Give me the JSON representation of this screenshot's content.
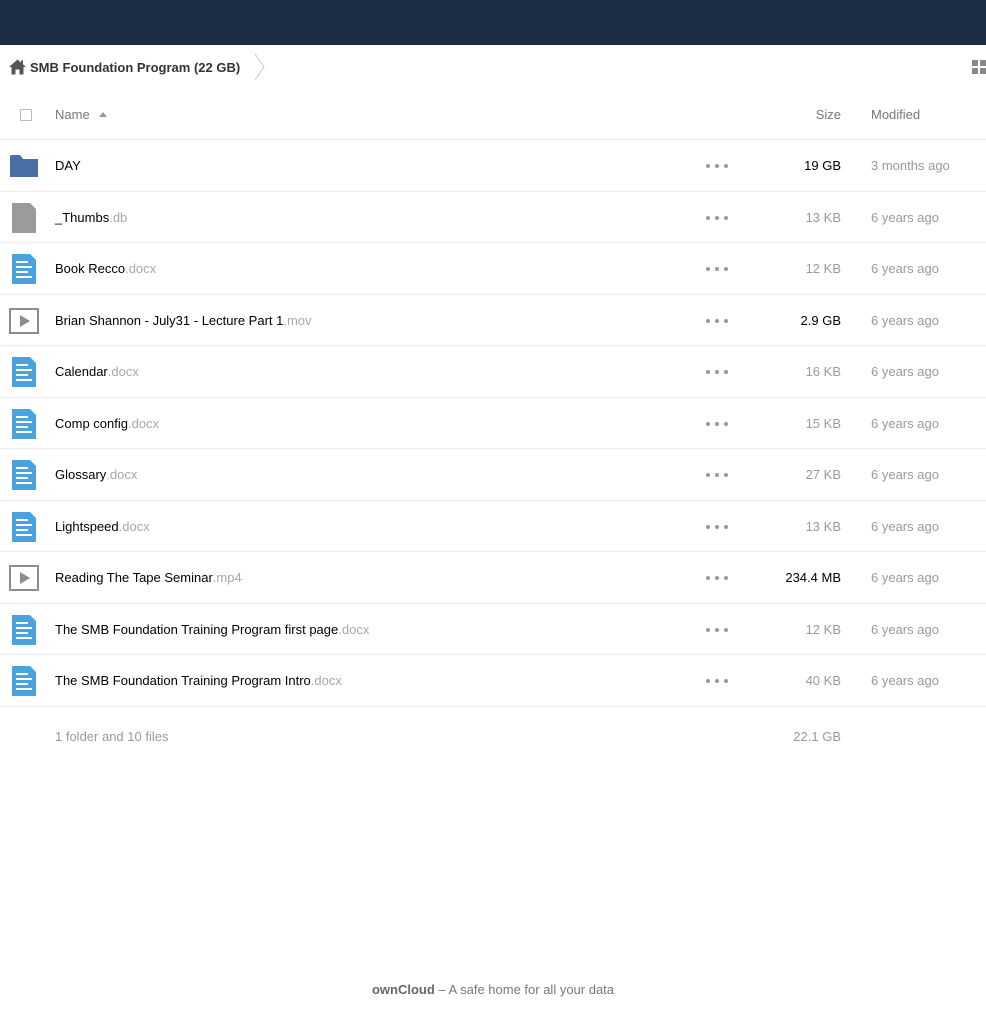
{
  "breadcrumb": {
    "label": "SMB Foundation Program (22 GB)"
  },
  "table": {
    "headers": {
      "name": "Name",
      "size": "Size",
      "modified": "Modified"
    },
    "rows": [
      {
        "type": "folder",
        "base": "DAY",
        "ext": "",
        "size": "19 GB",
        "size_color": "#000000",
        "modified": "3 months ago",
        "mod_color": "#999999"
      },
      {
        "type": "generic",
        "base": "_Thumbs",
        "ext": ".db",
        "size": "13 KB",
        "size_color": "#9a9a9a",
        "modified": "6 years ago",
        "mod_color": "#9a9a9a"
      },
      {
        "type": "document",
        "base": "Book Recco",
        "ext": ".docx",
        "size": "12 KB",
        "size_color": "#9a9a9a",
        "modified": "6 years ago",
        "mod_color": "#9a9a9a"
      },
      {
        "type": "video",
        "base": "Brian Shannon - July31 - Lecture Part 1",
        "ext": ".mov",
        "size": "2.9 GB",
        "size_color": "#000000",
        "modified": "6 years ago",
        "mod_color": "#9a9a9a"
      },
      {
        "type": "document",
        "base": "Calendar",
        "ext": ".docx",
        "size": "16 KB",
        "size_color": "#9a9a9a",
        "modified": "6 years ago",
        "mod_color": "#9a9a9a"
      },
      {
        "type": "document",
        "base": "Comp config",
        "ext": ".docx",
        "size": "15 KB",
        "size_color": "#9a9a9a",
        "modified": "6 years ago",
        "mod_color": "#9a9a9a"
      },
      {
        "type": "document",
        "base": "Glossary",
        "ext": ".docx",
        "size": "27 KB",
        "size_color": "#9a9a9a",
        "modified": "6 years ago",
        "mod_color": "#9a9a9a"
      },
      {
        "type": "document",
        "base": "Lightspeed",
        "ext": ".docx",
        "size": "13 KB",
        "size_color": "#9a9a9a",
        "modified": "6 years ago",
        "mod_color": "#9a9a9a"
      },
      {
        "type": "video",
        "base": "Reading The Tape Seminar",
        "ext": ".mp4",
        "size": "234.4 MB",
        "size_color": "#000000",
        "modified": "6 years ago",
        "mod_color": "#9a9a9a"
      },
      {
        "type": "document",
        "base": "The SMB Foundation Training Program first page",
        "ext": ".docx",
        "size": "12 KB",
        "size_color": "#9a9a9a",
        "modified": "6 years ago",
        "mod_color": "#9a9a9a"
      },
      {
        "type": "document",
        "base": "The SMB Foundation Training Program Intro",
        "ext": ".docx",
        "size": "40 KB",
        "size_color": "#9a9a9a",
        "modified": "6 years ago",
        "mod_color": "#9a9a9a"
      }
    ],
    "summary": {
      "text": "1 folder and 10 files",
      "size": "22.1 GB"
    }
  },
  "footer": {
    "brand": "ownCloud",
    "tagline": " – A safe home for all your data"
  },
  "colors": {
    "topbar": "#1d2d44",
    "folder": "#4a6fa5",
    "document": "#4aa3df",
    "generic": "#9b9b9b",
    "video": "#8d8d8d"
  }
}
